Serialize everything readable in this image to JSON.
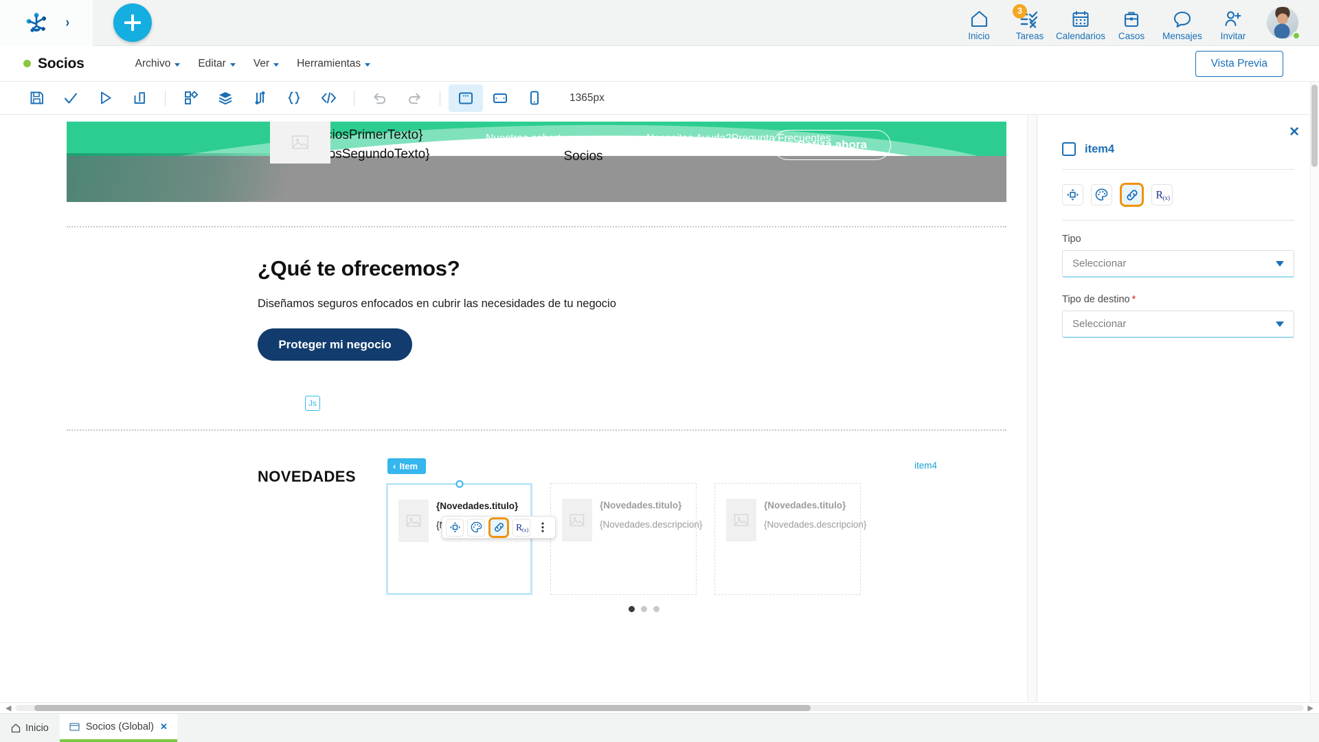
{
  "topbar": {
    "logo_name": "app-logo",
    "expand_label": "›",
    "add_button": "+",
    "nav": [
      {
        "label": "Inicio",
        "icon": "home-icon",
        "badge": null
      },
      {
        "label": "Tareas",
        "icon": "tasks-icon",
        "badge": "3"
      },
      {
        "label": "Calendarios",
        "icon": "calendar-icon",
        "badge": null
      },
      {
        "label": "Casos",
        "icon": "briefcase-icon",
        "badge": null
      },
      {
        "label": "Mensajes",
        "icon": "chat-icon",
        "badge": null
      },
      {
        "label": "Invitar",
        "icon": "add-user-icon",
        "badge": null
      }
    ]
  },
  "menubar": {
    "project_name": "Socios",
    "menus": [
      "Archivo",
      "Editar",
      "Ver",
      "Herramientas"
    ],
    "preview_label": "Vista Previa"
  },
  "toolbar": {
    "buttons": [
      "save-icon",
      "validate-check-icon",
      "run-icon",
      "publish-icon",
      "components-icon",
      "layers-icon",
      "flow-icon",
      "variables-icon",
      "code-icon",
      "undo-icon",
      "redo-icon",
      "desktop-icon",
      "tablet-icon",
      "mobile-icon"
    ],
    "viewport_size": "1365px"
  },
  "canvas": {
    "hero": {
      "brand_line1": "{SociosPrimerTexto}",
      "brand_line2": "{SociosSegundoTexto}",
      "links": [
        "Nuestras coberturas",
        "¿Necesitas Ayuda?Pregunta Frecuentes"
      ],
      "subtitle": "Socios",
      "cta_label": "Cotiza ahora"
    },
    "section1": {
      "heading": "¿Qué te ofrecemos?",
      "lead": "Diseñamos seguros enfocados en cubrir las necesidades de tu negocio",
      "js_badge": "Js",
      "button_label": "Proteger mi negocio"
    },
    "section2": {
      "heading": "NOVEDADES",
      "item_tag": "Item",
      "item_tag_arrow": "‹",
      "selected_label": "item4",
      "cards": [
        {
          "title": "{Novedades.titulo}",
          "desc": "{Novedades.descripcion}",
          "selected": true
        },
        {
          "title": "{Novedades.titulo}",
          "desc": "{Novedades.descripcion}",
          "selected": false
        },
        {
          "title": "{Novedades.titulo}",
          "desc": "{Novedades.descripcion}",
          "selected": false
        }
      ],
      "dots": [
        true,
        false,
        false
      ]
    },
    "float_toolbar": [
      "position-icon",
      "palette-icon",
      "link-icon",
      "formula-icon",
      "more-vertical-icon"
    ],
    "float_toolbar_active": "link-icon"
  },
  "right_panel": {
    "close_label": "✕",
    "item_name": "item4",
    "tabs": [
      "position-icon",
      "palette-icon",
      "link-icon",
      "formula-icon"
    ],
    "active_tab": "link-icon",
    "fields": [
      {
        "label": "Tipo",
        "required": false,
        "value": "Seleccionar"
      },
      {
        "label": "Tipo de destino",
        "required": true,
        "value": "Seleccionar"
      }
    ]
  },
  "bottom": {
    "home_tab": "Inicio",
    "open_tab": "Socios (Global)",
    "close_tab": "✕"
  },
  "colors": {
    "accent_blue": "#1a6fb5",
    "cyan": "#14aee0",
    "orange_highlight": "#f0920a",
    "green_dot": "#8cc63f",
    "hero_green": "#2dcd91",
    "cta_navy": "#123c6e",
    "badge_orange": "#f5a623"
  }
}
